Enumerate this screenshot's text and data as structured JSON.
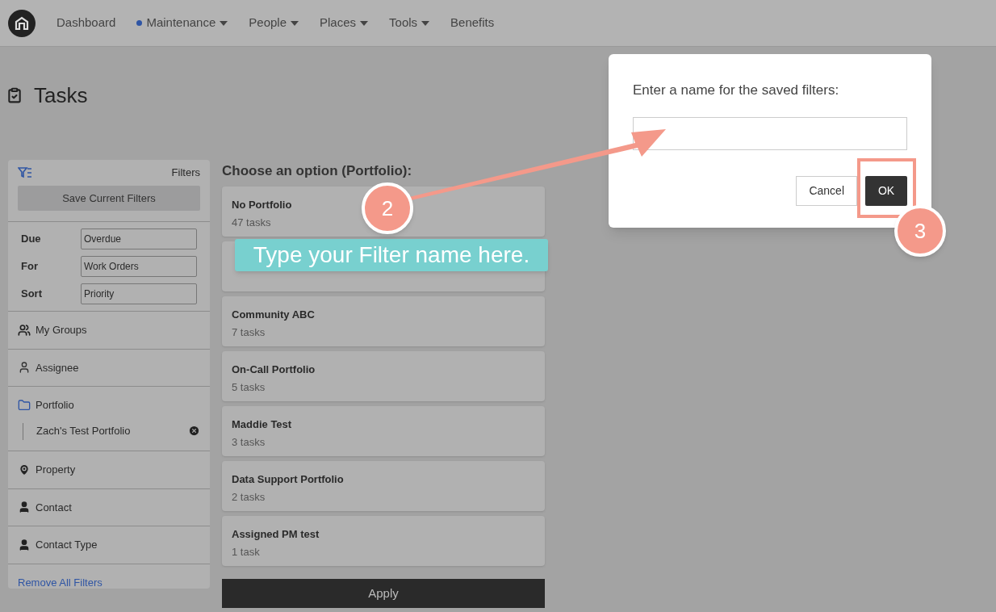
{
  "nav": {
    "items": [
      {
        "label": "Dashboard",
        "selected": false,
        "has_menu": false
      },
      {
        "label": "Maintenance",
        "selected": true,
        "has_menu": true
      },
      {
        "label": "People",
        "selected": false,
        "has_menu": true
      },
      {
        "label": "Places",
        "selected": false,
        "has_menu": true
      },
      {
        "label": "Tools",
        "selected": false,
        "has_menu": true
      },
      {
        "label": "Benefits",
        "selected": false,
        "has_menu": false
      }
    ]
  },
  "page_title": "Tasks",
  "filters": {
    "title": "Filters",
    "save_button": "Save Current Filters",
    "fields": [
      {
        "label": "Due",
        "value": "Overdue"
      },
      {
        "label": "For",
        "value": "Work Orders"
      },
      {
        "label": "Sort",
        "value": "Priority"
      }
    ],
    "sections": [
      {
        "label": "My Groups"
      },
      {
        "label": "Assignee"
      },
      {
        "label": "Portfolio",
        "children": [
          {
            "label": "Zach's Test Portfolio"
          }
        ]
      },
      {
        "label": "Property"
      },
      {
        "label": "Contact"
      },
      {
        "label": "Contact Type"
      }
    ],
    "remove_link": "Remove All Filters"
  },
  "options": {
    "heading": "Choose an option (Portfolio):",
    "cards": [
      {
        "kind": "option",
        "name": "No Portfolio",
        "count": "47 tasks"
      },
      {
        "kind": "covered"
      },
      {
        "kind": "option",
        "name": "Community ABC",
        "count": "7 tasks"
      },
      {
        "kind": "option",
        "name": "On-Call Portfolio",
        "count": "5 tasks"
      },
      {
        "kind": "option",
        "name": "Maddie Test",
        "count": "3 tasks"
      },
      {
        "kind": "option",
        "name": "Data Support Portfolio",
        "count": "2 tasks"
      },
      {
        "kind": "option",
        "name": "Assigned PM test",
        "count": "1 task"
      }
    ],
    "apply_button": "Apply"
  },
  "dialog": {
    "prompt": "Enter a name for the saved filters:",
    "cancel_button": "Cancel",
    "ok_button": "OK"
  },
  "annotations": {
    "tip": "Type your Filter name here.",
    "steps": [
      "2",
      "3"
    ]
  }
}
